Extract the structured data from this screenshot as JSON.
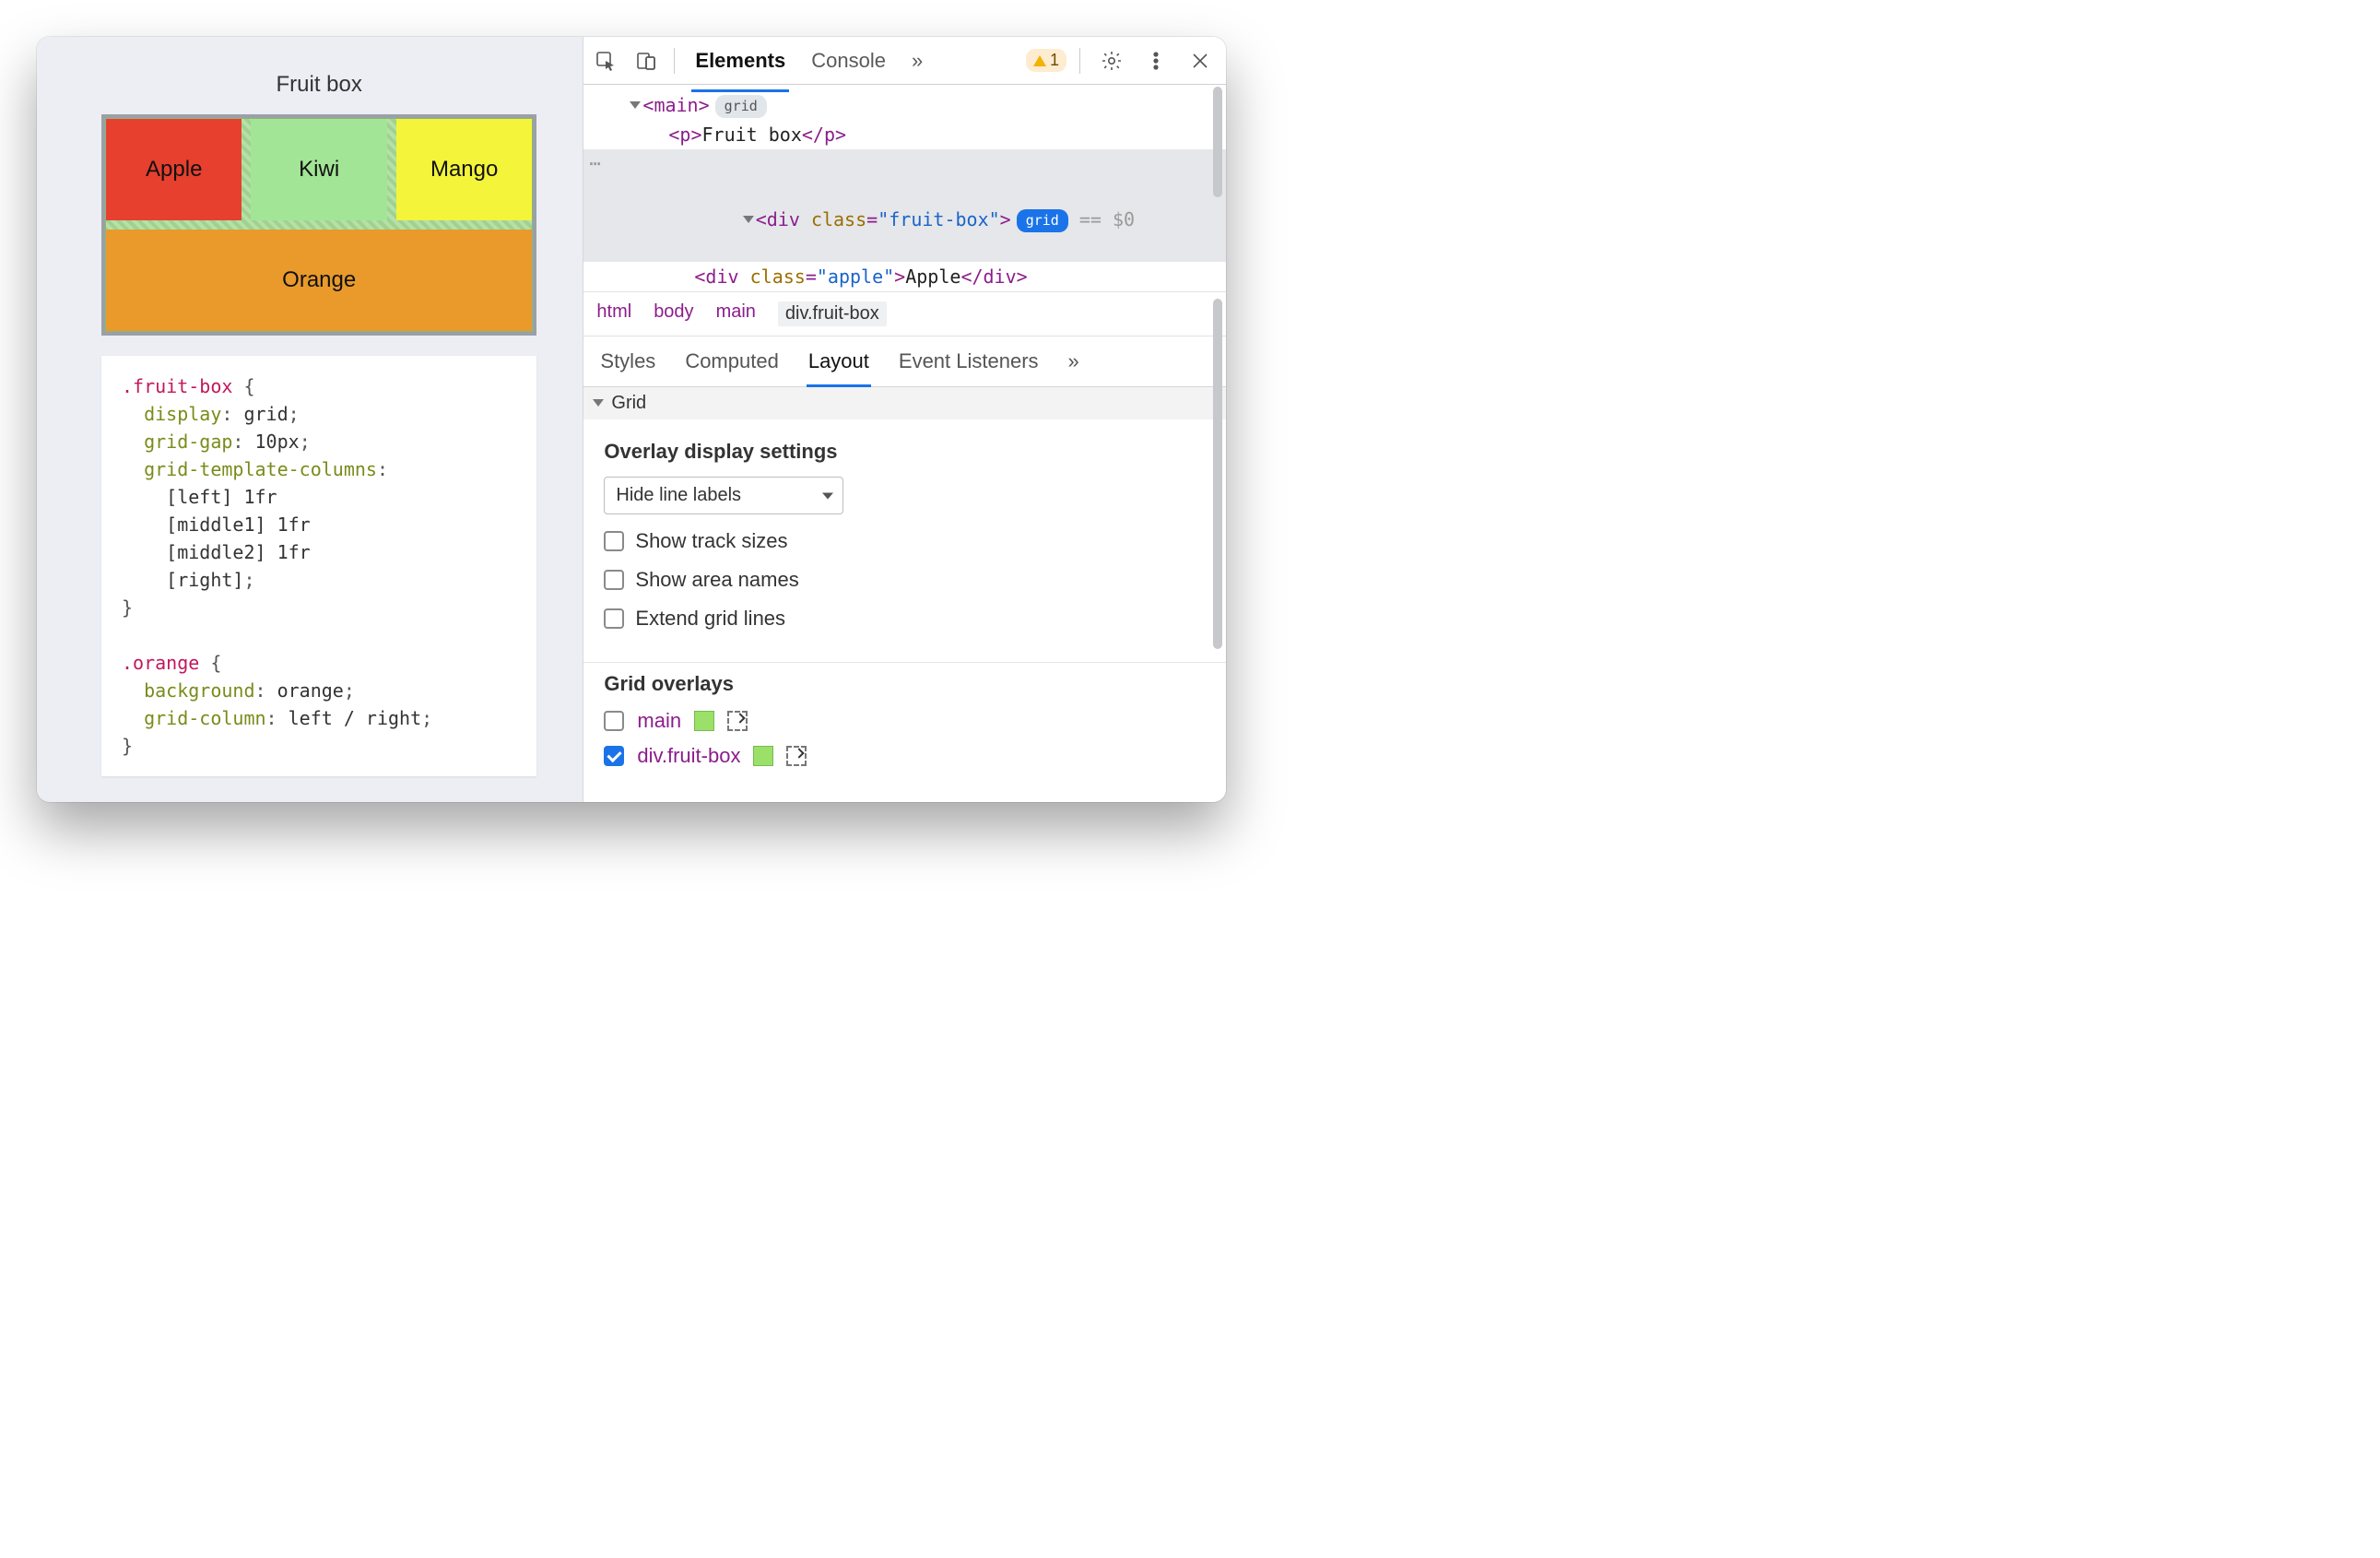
{
  "page": {
    "title": "Fruit box",
    "fruits": {
      "apple": "Apple",
      "kiwi": "Kiwi",
      "mango": "Mango",
      "orange": "Orange"
    },
    "css_block": ".fruit-box {\n  display: grid;\n  grid-gap: 10px;\n  grid-template-columns:\n    [left] 1fr\n    [middle1] 1fr\n    [middle2] 1fr\n    [right];\n}\n\n.orange {\n  background: orange;\n  grid-column: left / right;\n}"
  },
  "devtools": {
    "tabs": {
      "elements": "Elements",
      "console": "Console"
    },
    "more_label": "»",
    "warning_count": "1",
    "dom": {
      "main_tag": "main",
      "grid_badge": "grid",
      "p_text": "Fruit box",
      "div_class_attr": "class",
      "div_class_val": "\"fruit-box\"",
      "selected_suffix": " == $0",
      "apple_class": "\"apple\"",
      "apple_text": "Apple"
    },
    "breadcrumbs": [
      "html",
      "body",
      "main",
      "div.fruit-box"
    ],
    "subtabs": {
      "styles": "Styles",
      "computed": "Computed",
      "layout": "Layout",
      "event": "Event Listeners",
      "more": "»"
    },
    "layout_panel": {
      "section": "Grid",
      "overlay_title": "Overlay display settings",
      "select_value": "Hide line labels",
      "opts": {
        "track": "Show track sizes",
        "area": "Show area names",
        "extend": "Extend grid lines"
      },
      "overlays_title": "Grid overlays",
      "overlays": {
        "main": "main",
        "fruitbox": "div.fruit-box"
      }
    }
  }
}
